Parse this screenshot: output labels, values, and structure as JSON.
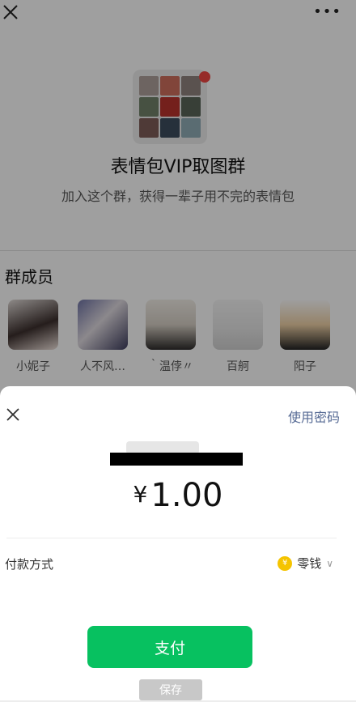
{
  "group": {
    "name": "表情包VIP取图群",
    "description": "加入这个群，获得一辈子用不完的表情包",
    "members_title": "群成员",
    "members": [
      {
        "name": "小妮子"
      },
      {
        "name": "人不风…"
      },
      {
        "name": "｀温侼〃"
      },
      {
        "name": "百舸"
      },
      {
        "name": "阳子"
      }
    ]
  },
  "payment": {
    "use_password_label": "使用密码",
    "currency_symbol": "¥",
    "amount": "1.00",
    "method_label": "付款方式",
    "method_value": "零钱",
    "pay_button_label": "支付",
    "save_button_label": "保存"
  },
  "colors": {
    "accent_green": "#07c160",
    "link_blue": "#576b95",
    "coin_gold": "#f5c400"
  }
}
